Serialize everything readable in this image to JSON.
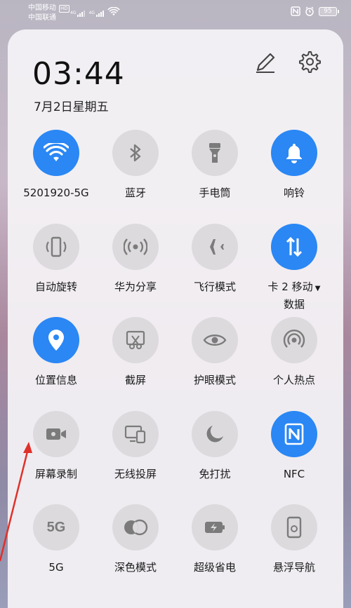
{
  "status_bar": {
    "carrier1": "中国移动",
    "carrier1_badge": "HD",
    "carrier2": "中国联通",
    "net1": "4G",
    "net2": "4G",
    "battery": "95"
  },
  "header": {
    "time": "03:44",
    "date": "7月2日星期五"
  },
  "tiles": [
    {
      "label": "5201920-5G",
      "icon": "wifi-icon",
      "on": true
    },
    {
      "label": "蓝牙",
      "icon": "bluetooth-icon",
      "on": false
    },
    {
      "label": "手电筒",
      "icon": "flashlight-icon",
      "on": false
    },
    {
      "label": "响铃",
      "icon": "bell-icon",
      "on": true
    },
    {
      "label": "自动旋转",
      "icon": "auto-rotate-icon",
      "on": false
    },
    {
      "label": "华为分享",
      "icon": "huawei-share-icon",
      "on": false
    },
    {
      "label": "飞行模式",
      "icon": "airplane-icon",
      "on": false
    },
    {
      "label": "卡 2 移动",
      "label2": "数据",
      "icon": "mobile-data-icon",
      "on": true
    },
    {
      "label": "位置信息",
      "icon": "location-icon",
      "on": true
    },
    {
      "label": "截屏",
      "icon": "screenshot-icon",
      "on": false
    },
    {
      "label": "护眼模式",
      "icon": "eye-icon",
      "on": false
    },
    {
      "label": "个人热点",
      "icon": "hotspot-icon",
      "on": false
    },
    {
      "label": "屏幕录制",
      "icon": "screen-record-icon",
      "on": false
    },
    {
      "label": "无线投屏",
      "icon": "wireless-projection-icon",
      "on": false
    },
    {
      "label": "免打扰",
      "icon": "moon-icon",
      "on": false
    },
    {
      "label": "NFC",
      "icon": "nfc-icon",
      "on": true
    },
    {
      "label": "5G",
      "icon": "5g-icon",
      "icon_text": "5G",
      "on": false
    },
    {
      "label": "深色模式",
      "icon": "dark-mode-icon",
      "on": false
    },
    {
      "label": "超级省电",
      "icon": "battery-saver-icon",
      "on": false
    },
    {
      "label": "悬浮导航",
      "icon": "floating-nav-icon",
      "on": false
    }
  ],
  "colors": {
    "active": "#2a87f4",
    "inactive": "#dcdadd",
    "annotation_arrow": "#e0302a"
  }
}
